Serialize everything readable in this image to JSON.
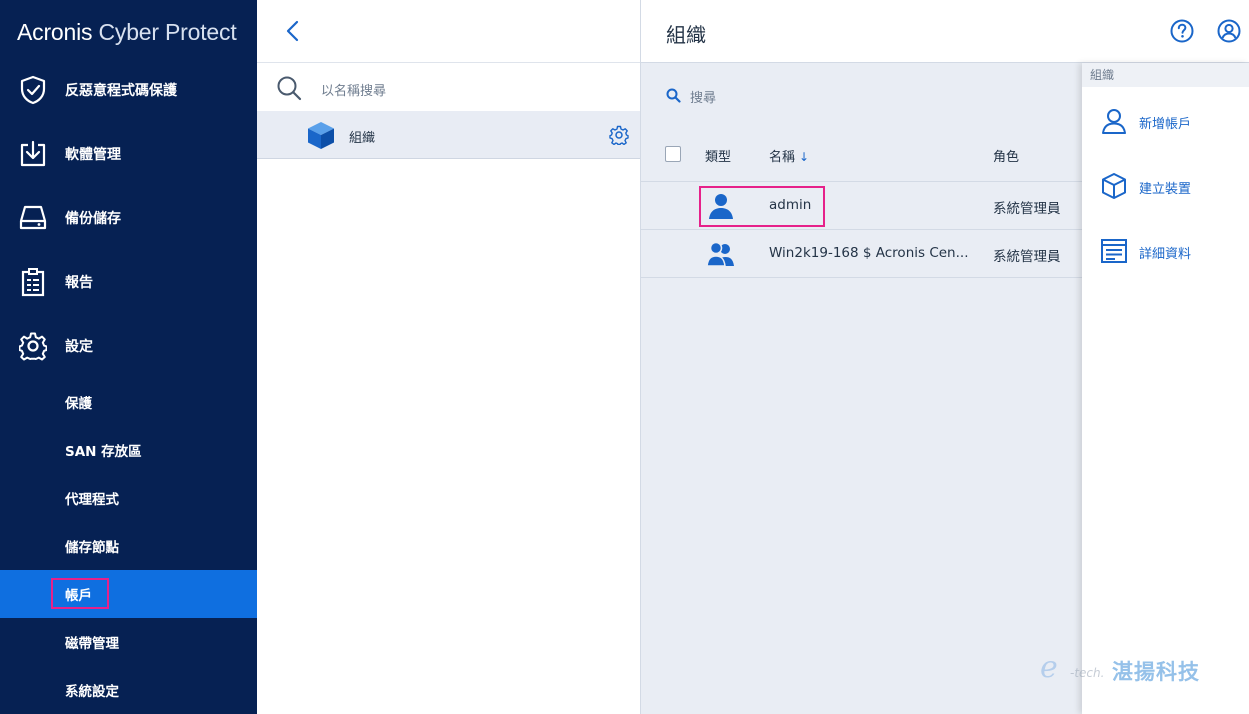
{
  "sidebar": {
    "brand_primary": "Acronis",
    "brand_secondary": "Cyber Protect",
    "main_items": [
      {
        "label": "反惡意程式碼保護",
        "icon": "shield-check-icon"
      },
      {
        "label": "軟體管理",
        "icon": "download-tray-icon"
      },
      {
        "label": "備份儲存",
        "icon": "storage-drive-icon"
      },
      {
        "label": "報告",
        "icon": "clipboard-report-icon"
      },
      {
        "label": "設定",
        "icon": "gear-icon"
      }
    ],
    "sub_items": [
      {
        "label": "保護"
      },
      {
        "label": "SAN 存放區"
      },
      {
        "label": "代理程式"
      },
      {
        "label": "儲存節點"
      },
      {
        "label": "帳戶",
        "active": true
      },
      {
        "label": "磁帶管理"
      },
      {
        "label": "系統設定"
      }
    ]
  },
  "midpanel": {
    "search_placeholder": "以名稱搜尋",
    "org_item": "組織"
  },
  "main": {
    "title": "組織",
    "search_placeholder": "搜尋",
    "columns": {
      "type": "類型",
      "name": "名稱",
      "sort_arrow": "↓",
      "role": "角色"
    },
    "rows": [
      {
        "type_icon": "user-icon",
        "name": "admin",
        "role": "系統管理員"
      },
      {
        "type_icon": "user-group-icon",
        "name": "Win2k19-168 $ Acronis Cen...",
        "role": "系統管理員"
      }
    ]
  },
  "rightpanel": {
    "title": "組織",
    "actions": [
      {
        "label": "新增帳戶",
        "icon": "add-user-icon"
      },
      {
        "label": "建立裝置",
        "icon": "cube-icon"
      },
      {
        "label": "詳細資料",
        "icon": "details-list-icon"
      }
    ]
  },
  "watermark": {
    "letter": "e",
    "tech": "-tech.",
    "text": "湛揚科技"
  },
  "colors": {
    "sidebar_bg": "#062153",
    "active_item": "#0f6fe0",
    "highlight_box": "#e6218a",
    "accent": "#1a66c9"
  }
}
